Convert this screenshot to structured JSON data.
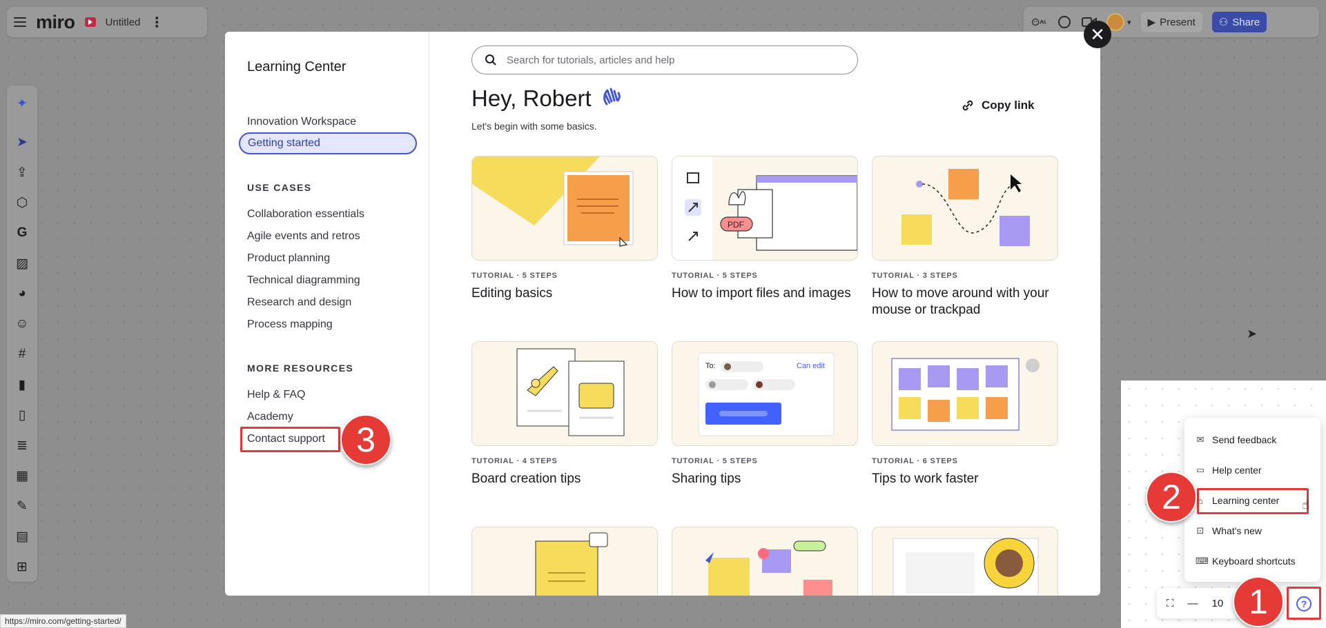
{
  "app": {
    "logo": "miro",
    "board_name": "Untitled"
  },
  "topbar": {
    "present_label": "Present",
    "share_label": "Share"
  },
  "learning_center": {
    "title": "Learning Center",
    "nav_top": [
      "Innovation Workspace",
      "Getting started"
    ],
    "active_item": "Getting started",
    "use_cases_heading": "USE CASES",
    "use_cases": [
      "Collaboration essentials",
      "Agile events and retros",
      "Product planning",
      "Technical diagramming",
      "Research and design",
      "Process mapping"
    ],
    "more_resources_heading": "MORE RESOURCES",
    "more_resources": [
      "Help & FAQ",
      "Academy",
      "Contact support"
    ]
  },
  "main": {
    "search_placeholder": "Search for tutorials, articles and help",
    "greeting": "Hey, Robert",
    "subtext": "Let's begin with some basics.",
    "copy_link": "Copy link",
    "cards": [
      {
        "meta": "TUTORIAL · 5 STEPS",
        "title": "Editing basics"
      },
      {
        "meta": "TUTORIAL · 5 STEPS",
        "title": "How to import files and images"
      },
      {
        "meta": "TUTORIAL · 3 STEPS",
        "title": "How to move around with your mouse or trackpad"
      },
      {
        "meta": "TUTORIAL · 4 STEPS",
        "title": "Board creation tips"
      },
      {
        "meta": "TUTORIAL · 5 STEPS",
        "title": "Sharing tips"
      },
      {
        "meta": "TUTORIAL · 6 STEPS",
        "title": "Tips to work faster"
      }
    ],
    "pdf_label": "PDF",
    "share_to": "To:",
    "can_edit": "Can edit"
  },
  "help_menu": {
    "items": [
      "Send feedback",
      "Help center",
      "Learning center",
      "What's new",
      "Keyboard shortcuts"
    ]
  },
  "zoom": {
    "value": "10"
  },
  "annotations": {
    "step1": "1",
    "step2": "2",
    "step3": "3"
  },
  "status_url": "https://miro.com/getting-started/",
  "colors": {
    "accent": "#4255d4",
    "annotation_red": "#e53a35",
    "share_button": "#3a4ba8"
  }
}
